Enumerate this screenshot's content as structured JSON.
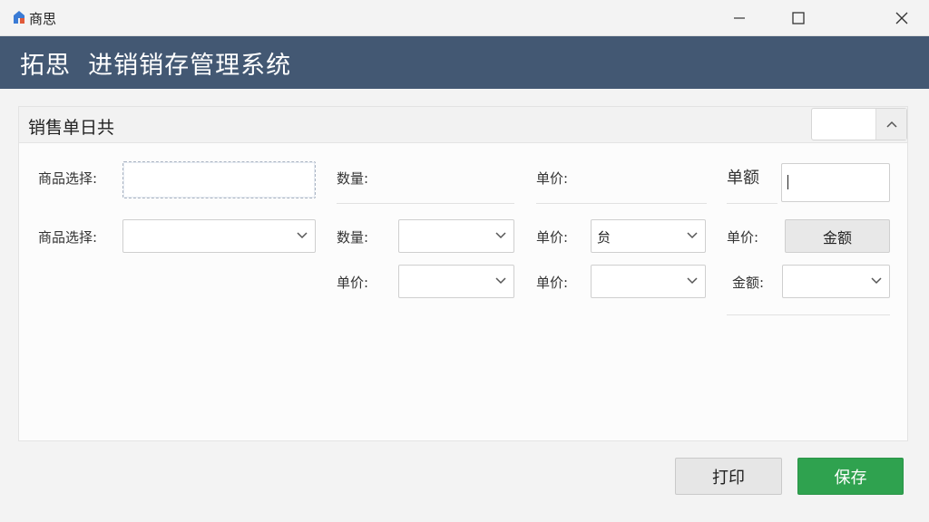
{
  "window": {
    "title": "商思",
    "icon": "house-logo-icon",
    "controls": [
      "minimize-icon",
      "maximize-icon",
      "close-icon"
    ]
  },
  "header": {
    "title": "拓思  进销销存管理系统"
  },
  "panel": {
    "title": "销售单日共",
    "collapse_value": ""
  },
  "form": {
    "row1": {
      "product_label": "商品选择:",
      "product_value": "",
      "quantity_label": "数量:",
      "price_label": "单价:",
      "amount_label": "单额",
      "amount_value": ""
    },
    "row2": {
      "product_label": "商品选择:",
      "product_value": "",
      "quantity_label": "数量:",
      "quantity_value": "",
      "price_label": "单价:",
      "price_value": "贠",
      "price2_label": "单价:",
      "amount_button": "金额"
    },
    "row3": {
      "price_label": "单价:",
      "price_value": "",
      "price2_label": "单价:",
      "price2_value": "",
      "amount_label": "金额:",
      "amount_value": ""
    }
  },
  "footer": {
    "print_label": "打印",
    "save_label": "保存"
  },
  "colors": {
    "banner": "#435873",
    "save_button": "#2fa24f",
    "background": "#f3f3f3"
  }
}
